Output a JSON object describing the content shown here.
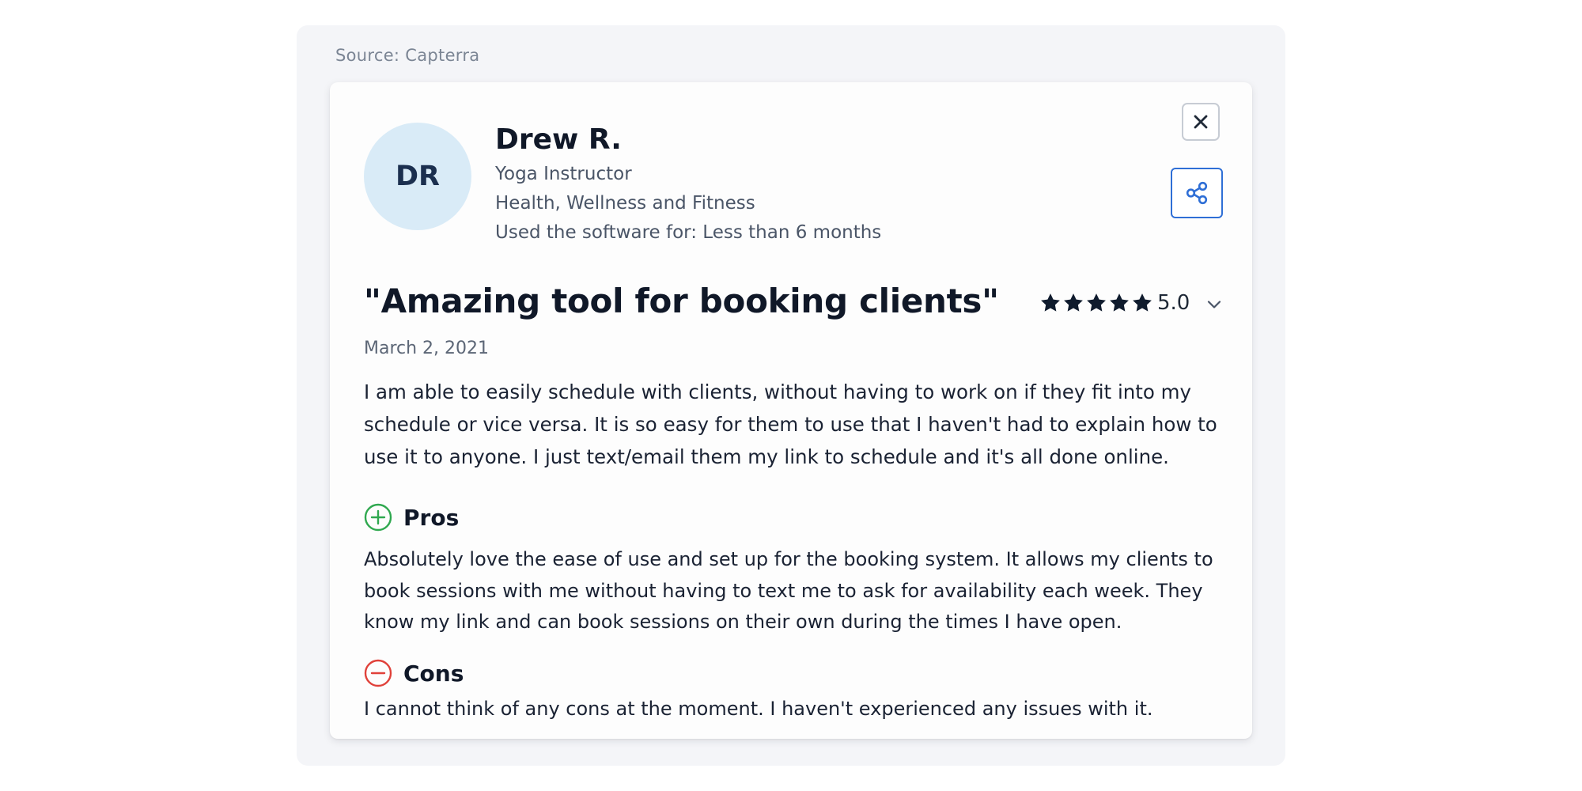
{
  "source_label": "Source: Capterra",
  "reviewer": {
    "initials": "DR",
    "name": "Drew R.",
    "role": "Yoga Instructor",
    "industry": "Health, Wellness and Fitness",
    "usage": "Used the software for: Less than 6 months"
  },
  "review": {
    "title": "\"Amazing tool for booking clients\"",
    "rating": 5,
    "rating_max": 5,
    "rating_label": "5.0",
    "date": "March 2, 2021",
    "body": "I am able to easily schedule with clients, without having to work on if they fit into my schedule or vice versa. It is so easy for them to use that I haven't had to explain how to use it to anyone. I just text/email them my link to schedule and it's all done online.",
    "pros_heading": "Pros",
    "pros_text": "Absolutely love the ease of use and set up for the booking system. It allows my clients to book sessions with me without having to text me to ask for availability each week. They know my link and can book sessions on their own during the times I have open.",
    "cons_heading": "Cons",
    "cons_text": "I cannot think of any cons at the moment. I haven't experienced any issues with it."
  },
  "icons": {
    "close": "close-icon",
    "share": "share-icon",
    "star": "star-icon",
    "chevron": "chevron-down-icon",
    "pros": "plus-circle-icon",
    "cons": "minus-circle-icon"
  },
  "colors": {
    "avatar_bg": "#d9ebf7",
    "share_accent": "#2f6fd6",
    "pros_green": "#2fa84f",
    "cons_red": "#e0413a",
    "star": "#0f1b2d"
  }
}
